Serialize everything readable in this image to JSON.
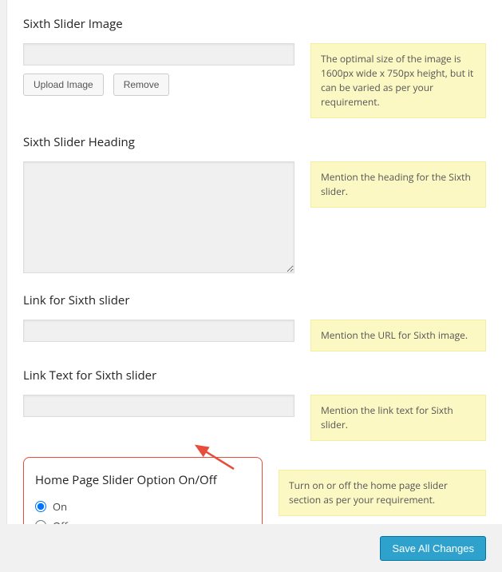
{
  "sections": {
    "image": {
      "title": "Sixth Slider Image",
      "value": "",
      "upload_label": "Upload Image",
      "remove_label": "Remove",
      "hint": "The optimal size of the image is 1600px wide x 750px height, but it can be varied as per your requirement."
    },
    "heading": {
      "title": "Sixth Slider Heading",
      "value": "",
      "hint": "Mention the heading for the Sixth slider."
    },
    "link": {
      "title": "Link for Sixth slider",
      "value": "",
      "hint": "Mention the URL for Sixth image."
    },
    "linktext": {
      "title": "Link Text for Sixth slider",
      "value": "",
      "hint": "Mention the link text for Sixth slider."
    },
    "onoff": {
      "title": "Home Page Slider Option On/Off",
      "on_label": "On",
      "off_label": "Off",
      "selected": "on",
      "hint": "Turn on or off the home page slider section as per your requirement."
    }
  },
  "footer": {
    "save_label": "Save All Changes"
  },
  "colors": {
    "highlight": "#e74c3c",
    "hint_bg": "#fcf8c3",
    "primary": "#2ea2cc"
  }
}
